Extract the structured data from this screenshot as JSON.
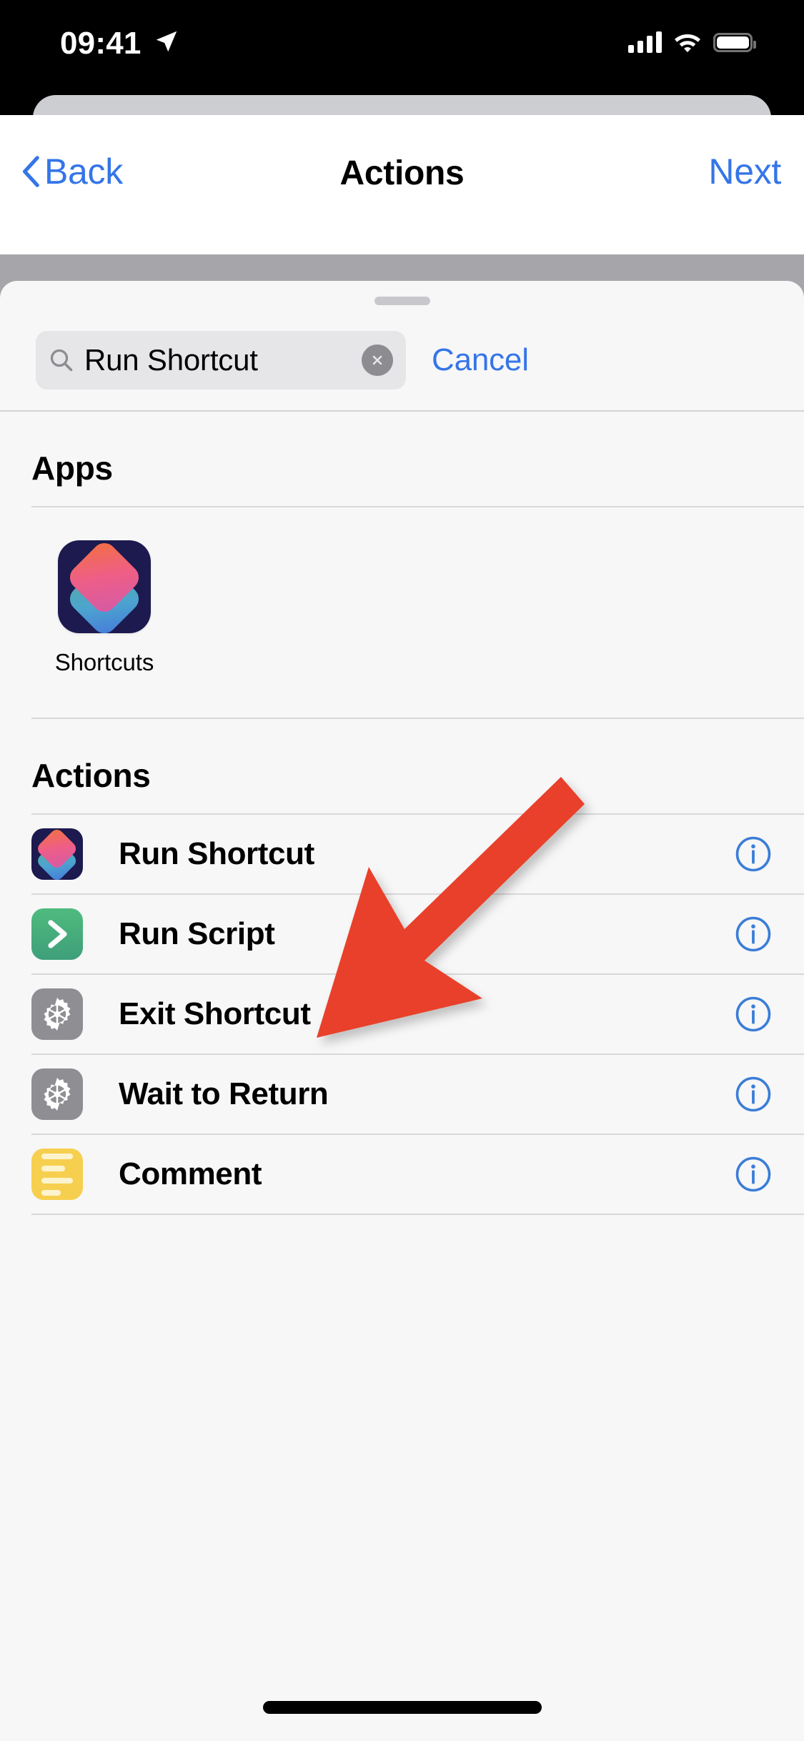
{
  "status_bar": {
    "time": "09:41",
    "location_icon": "location-arrow-icon",
    "cellular_icon": "cellular-bars-icon",
    "wifi_icon": "wifi-icon",
    "battery_icon": "battery-full-icon"
  },
  "navbar": {
    "back_label": "Back",
    "title": "Actions",
    "next_label": "Next",
    "back_icon": "chevron-left-icon",
    "tint_color": "#3575e8"
  },
  "sheet": {
    "grabber": "drag-handle"
  },
  "search": {
    "value": "Run Shortcut",
    "placeholder": "Search",
    "search_icon": "magnifier-icon",
    "clear_icon": "clear-circle-icon",
    "cancel_label": "Cancel"
  },
  "apps_section": {
    "title": "Apps",
    "apps": [
      {
        "label": "Shortcuts",
        "icon": "shortcuts-app-icon"
      }
    ]
  },
  "actions_section": {
    "title": "Actions",
    "info_icon": "info-circle-icon",
    "rows": [
      {
        "label": "Run Shortcut",
        "icon": "shortcuts-action-icon",
        "icon_style": "shortcuts"
      },
      {
        "label": "Run Script",
        "icon": "chevron-right-script-icon",
        "icon_style": "script"
      },
      {
        "label": "Exit Shortcut",
        "icon": "gear-icon",
        "icon_style": "gear"
      },
      {
        "label": "Wait to Return",
        "icon": "gear-icon",
        "icon_style": "gear"
      },
      {
        "label": "Comment",
        "icon": "comment-lines-icon",
        "icon_style": "comment"
      }
    ]
  },
  "annotation": {
    "arrow_color": "#e8412a",
    "arrow_name": "red-pointer-arrow",
    "points_to": "Run Shortcut"
  },
  "home_indicator": "home-indicator"
}
